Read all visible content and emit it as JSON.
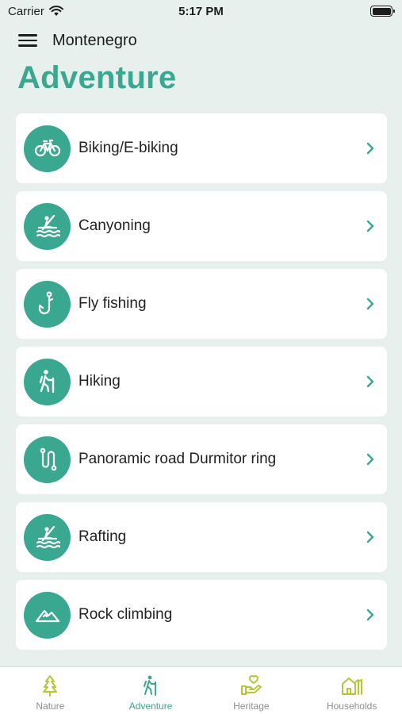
{
  "status_bar": {
    "carrier": "Carrier",
    "time": "5:17 PM"
  },
  "nav": {
    "title": "Montenegro"
  },
  "page": {
    "title": "Adventure"
  },
  "items": [
    {
      "label": "Biking/E-biking",
      "icon": "bike-icon"
    },
    {
      "label": "Canyoning",
      "icon": "kayak-icon"
    },
    {
      "label": "Fly fishing",
      "icon": "fishing-hook-icon"
    },
    {
      "label": "Hiking",
      "icon": "hiker-icon"
    },
    {
      "label": "Panoramic road Durmitor ring",
      "icon": "winding-road-icon"
    },
    {
      "label": "Rafting",
      "icon": "kayak-icon"
    },
    {
      "label": "Rock climbing",
      "icon": "mountain-icon"
    }
  ],
  "tabs": [
    {
      "label": "Nature",
      "icon": "tree-icon",
      "active": false
    },
    {
      "label": "Adventure",
      "icon": "hiker-icon",
      "active": true
    },
    {
      "label": "Heritage",
      "icon": "hand-heart-icon",
      "active": false
    },
    {
      "label": "Households",
      "icon": "house-icon",
      "active": false
    }
  ],
  "colors": {
    "accent": "#3aa791",
    "background": "#e8f0ed",
    "tab_icon": "#b3c837",
    "inactive_label": "#8e8e93"
  }
}
